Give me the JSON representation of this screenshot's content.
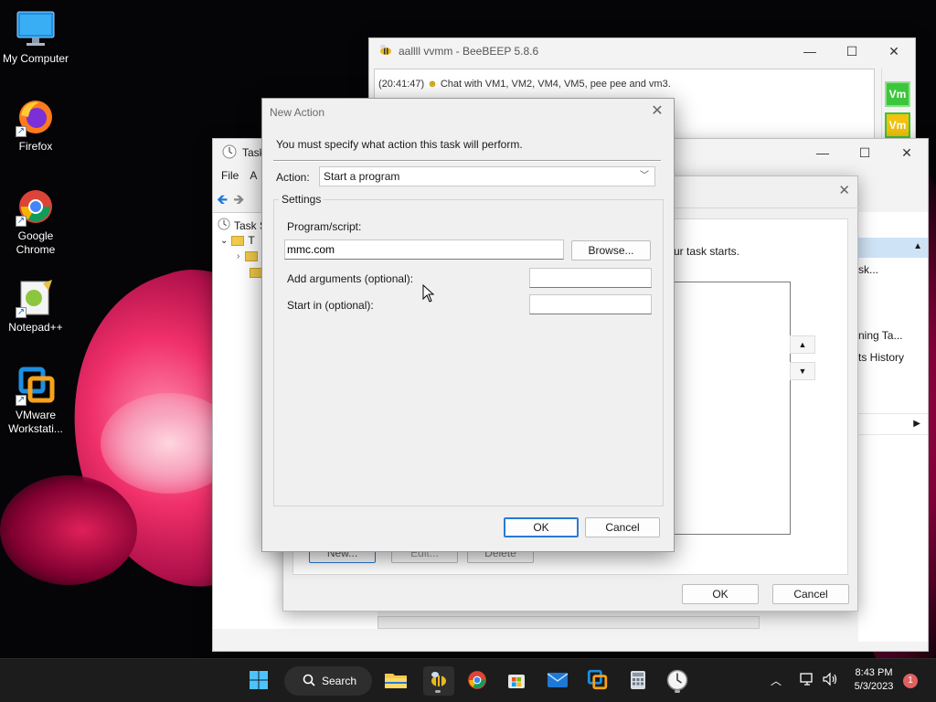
{
  "desktop": {
    "icons": [
      {
        "label": "My Computer"
      },
      {
        "label": "Firefox"
      },
      {
        "label": "Google Chrome"
      },
      {
        "label": "Notepad++"
      },
      {
        "label": "VMware Workstati..."
      }
    ]
  },
  "beebeep": {
    "title": "aallll vvmm - BeeBEEP 5.8.6",
    "chat_time": "(20:41:47)",
    "chat_text": "Chat with VM1, VM2, VM4, VM5, pee pee and vm3.",
    "side_badge_1": "Vm",
    "side_badge_2": "Vm"
  },
  "task_scheduler": {
    "title_partial": "Task",
    "menu_file": "File",
    "menu_action_partial": "A",
    "tree_root_partial": "Task S",
    "tree_child_partial": "T",
    "actions_item_1": "sk...",
    "actions_item_2": "ning Ta...",
    "actions_item_3": "ts History"
  },
  "create_task": {
    "hint_partial": "ur task starts.",
    "new_btn": "New...",
    "edit_btn": "Edit...",
    "delete_btn": "Delete",
    "ok": "OK",
    "cancel": "Cancel"
  },
  "new_action": {
    "title": "New Action",
    "message": "You must specify what action this task will perform.",
    "action_label": "Action:",
    "action_value": "Start a program",
    "settings_legend": "Settings",
    "program_label": "Program/script:",
    "program_value": "mmc.com",
    "browse": "Browse...",
    "args_label": "Add arguments (optional):",
    "args_value": "",
    "startin_label": "Start in (optional):",
    "startin_value": "",
    "ok": "OK",
    "cancel": "Cancel"
  },
  "taskbar": {
    "search_label": "Search",
    "time": "8:43 PM",
    "date": "5/3/2023",
    "notification_count": "1"
  }
}
